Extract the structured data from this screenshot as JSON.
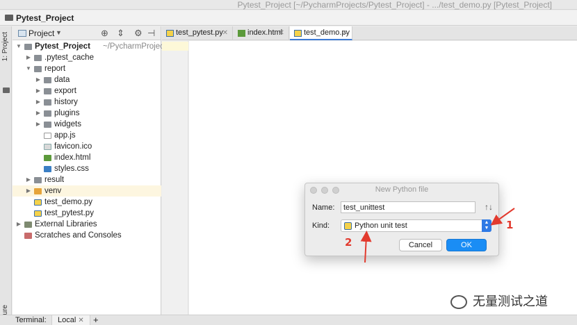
{
  "window": {
    "title": "Pytest_Project [~/PycharmProjects/Pytest_Project] - .../test_demo.py [Pytest_Project]",
    "nav_project": "Pytest_Project"
  },
  "side_strip": {
    "project_label": "1: Project",
    "structure_label": "ure"
  },
  "project_panel": {
    "header_label": "Project",
    "tree": [
      {
        "label": "Pytest_Project",
        "suffix": "~/PycharmProjects/P",
        "icon": "folder-icon",
        "depth": 0,
        "expanded": true,
        "bold": true
      },
      {
        "label": ".pytest_cache",
        "icon": "folder-icon",
        "depth": 1,
        "expanded": false
      },
      {
        "label": "report",
        "icon": "folder-icon",
        "depth": 1,
        "expanded": true
      },
      {
        "label": "data",
        "icon": "folder-icon",
        "depth": 2,
        "expanded": false
      },
      {
        "label": "export",
        "icon": "folder-icon",
        "depth": 2,
        "expanded": false
      },
      {
        "label": "history",
        "icon": "folder-icon",
        "depth": 2,
        "expanded": false
      },
      {
        "label": "plugins",
        "icon": "folder-icon",
        "depth": 2,
        "expanded": false
      },
      {
        "label": "widgets",
        "icon": "folder-icon",
        "depth": 2,
        "expanded": false
      },
      {
        "label": "app.js",
        "icon": "js-file-icon",
        "depth": 2
      },
      {
        "label": "favicon.ico",
        "icon": "image-file-icon",
        "depth": 2
      },
      {
        "label": "index.html",
        "icon": "html-file-icon",
        "depth": 2
      },
      {
        "label": "styles.css",
        "icon": "css-file-icon",
        "depth": 2
      },
      {
        "label": "result",
        "icon": "folder-icon",
        "depth": 1,
        "expanded": false
      },
      {
        "label": "venv",
        "icon": "excluded-folder-icon",
        "depth": 1,
        "expanded": false,
        "selected": true
      },
      {
        "label": "test_demo.py",
        "icon": "python-file-icon",
        "depth": 1
      },
      {
        "label": "test_pytest.py",
        "icon": "python-file-icon",
        "depth": 1
      },
      {
        "label": "External Libraries",
        "icon": "library-icon",
        "depth": 0,
        "expanded": false
      },
      {
        "label": "Scratches and Consoles",
        "icon": "scratch-icon",
        "depth": 0
      }
    ]
  },
  "editor_tabs": [
    {
      "label": "test_pytest.py",
      "icon": "python-file-icon",
      "active": false
    },
    {
      "label": "index.html",
      "icon": "html-file-icon",
      "active": false
    },
    {
      "label": "test_demo.py",
      "icon": "python-file-icon",
      "active": true
    }
  ],
  "bottom_bar": {
    "terminal_label": "Terminal:",
    "tab_label": "Local"
  },
  "dialog": {
    "title": "New Python file",
    "name_label": "Name:",
    "name_value": "test_unittest",
    "kind_label": "Kind:",
    "kind_value": "Python unit test",
    "cancel_label": "Cancel",
    "ok_label": "OK"
  },
  "annotations": {
    "marker_1": "1",
    "marker_2": "2",
    "color": "#e23a2e"
  },
  "watermark": {
    "text": "无量测试之道"
  }
}
